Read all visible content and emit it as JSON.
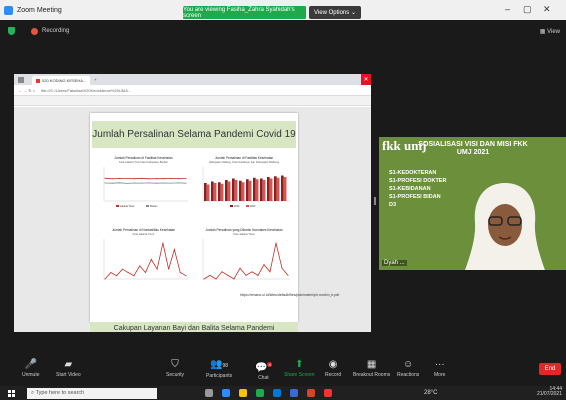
{
  "window": {
    "title": "Zoom Meeting"
  },
  "banner": {
    "text": "You are viewing Fasiha_Zahra Syahidah's screen",
    "view_options": "View Options ⌄"
  },
  "meeting": {
    "recording_label": "Recording",
    "view_label": "View"
  },
  "browser": {
    "tab_label": "020 KODING KESEHA...",
    "address": "file:///C:/Users/Fakultas%20Kedokteran%20UMJ/..."
  },
  "slide": {
    "title": "Jumlah Persalinan Selama Pandemi Covid 19",
    "next_title": "Cakupan Layanan Bayi dan Balita Selama Pandemi",
    "source": "https://emanu.ui.id/sites/default/files/pub/materi/ph.rsm4m_tr.pdf"
  },
  "chart_data": [
    {
      "type": "line",
      "title": "Jumlah Persalinan di Fasilitas Kesehatan",
      "subtitle": "Kota Jakarta Timur dan Kabupaten Banten",
      "series": [
        {
          "name": "Jakarta Timur",
          "values": [
            1900,
            1850,
            1880,
            1870,
            1860,
            1890,
            1850,
            1870,
            1860,
            1880,
            1860,
            1870
          ]
        },
        {
          "name": "Banten",
          "values": [
            1500,
            1480,
            1520,
            1470,
            1500,
            1490,
            1510,
            1480,
            1500,
            1490,
            1510,
            1480
          ]
        }
      ],
      "ylim": [
        0,
        2500
      ]
    },
    {
      "type": "bar",
      "title": "Jumlah Persalinan di Fasilitas Kesehatan",
      "subtitle": "Kabupaten Malang, Kota Surabaya, dan Kabupaten Madiung",
      "series": [
        {
          "name": "2019",
          "values": [
            120,
            130,
            125,
            140,
            150,
            135,
            145,
            155,
            150,
            160,
            165,
            170
          ]
        },
        {
          "name": "2020",
          "values": [
            110,
            120,
            115,
            130,
            140,
            125,
            135,
            145,
            140,
            150,
            155,
            160
          ]
        }
      ],
      "ylim": [
        0,
        200
      ]
    },
    {
      "type": "line",
      "title": "Jumlah Persalinan di Nonfasilitas Kesehatan",
      "subtitle": "Kota Jakarta Timur",
      "values": [
        3,
        5,
        4,
        6,
        5,
        4,
        7,
        5,
        9,
        6,
        14,
        6,
        12,
        5,
        4
      ]
    },
    {
      "type": "line",
      "title": "Jumlah Persalinan yang Dibantu Nonnakes Kesehatan",
      "subtitle": "Kota Jakarta Timur",
      "values": [
        2,
        3,
        2,
        4,
        3,
        2,
        5,
        3,
        4,
        3,
        6,
        4,
        12,
        5,
        3
      ]
    }
  ],
  "video": {
    "logo": "fkk umj",
    "title": "SOSIALISASI VISI DAN MISI FKK UMJ 2021",
    "programs": [
      "S1-KEDOKTERAN",
      "S1-PROFESI DOKTER",
      "S1-KEBIDANAN",
      "S1-PROFESI BIDAN",
      "D3"
    ],
    "participant": "Dyah ..."
  },
  "toolbar": {
    "unmute": "Unmute",
    "start_video": "Start Video",
    "security": "Security",
    "participants": "Participants",
    "participants_count": "98",
    "chat": "Chat",
    "chat_badge": "4",
    "share_screen": "Share Screen",
    "record": "Record",
    "breakout": "Breakout Rooms",
    "reactions": "Reactions",
    "more": "More",
    "end": "End"
  },
  "taskbar": {
    "search_placeholder": "Type here to search",
    "temperature": "28°C",
    "time": "14:44",
    "date": "21/07/2021"
  },
  "colors": {
    "zoom_blue": "#2d8cff",
    "share_green": "#1ea94a",
    "end_red": "#e02828",
    "slide_title_bg": "#d8e6c4"
  }
}
